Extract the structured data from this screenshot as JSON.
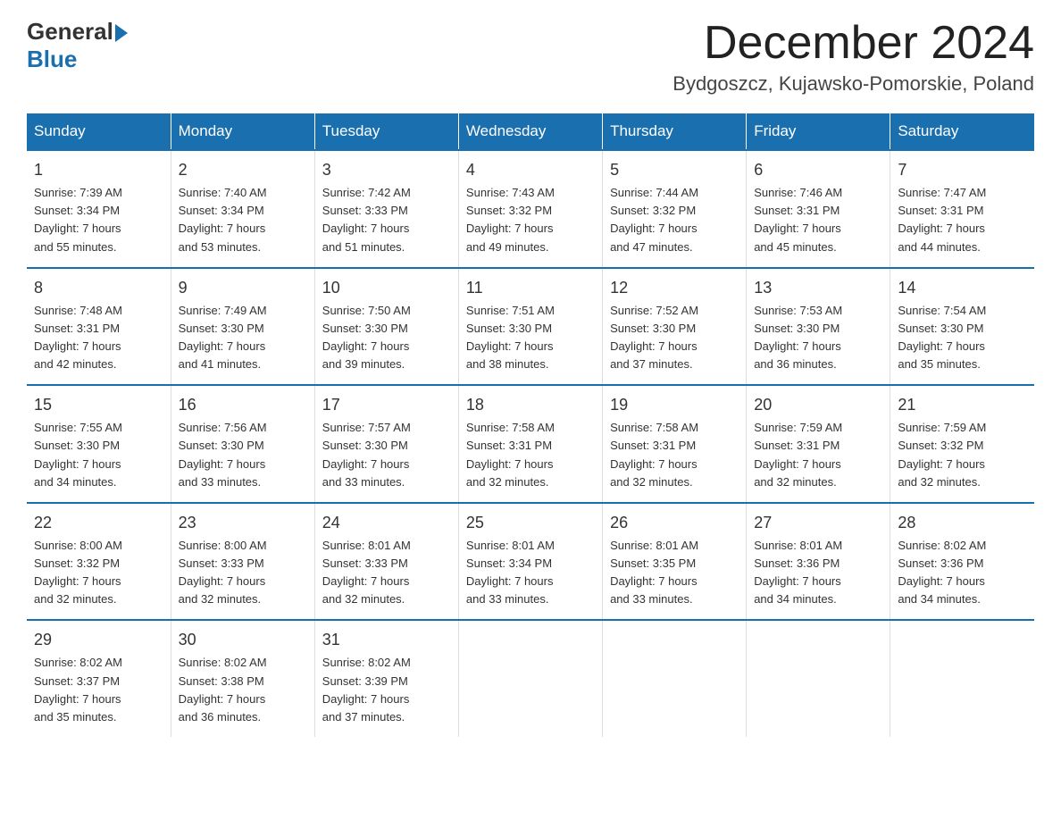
{
  "header": {
    "logo_general": "General",
    "logo_blue": "Blue",
    "month_title": "December 2024",
    "location": "Bydgoszcz, Kujawsko-Pomorskie, Poland"
  },
  "columns": [
    "Sunday",
    "Monday",
    "Tuesday",
    "Wednesday",
    "Thursday",
    "Friday",
    "Saturday"
  ],
  "weeks": [
    [
      {
        "day": "1",
        "info": "Sunrise: 7:39 AM\nSunset: 3:34 PM\nDaylight: 7 hours\nand 55 minutes."
      },
      {
        "day": "2",
        "info": "Sunrise: 7:40 AM\nSunset: 3:34 PM\nDaylight: 7 hours\nand 53 minutes."
      },
      {
        "day": "3",
        "info": "Sunrise: 7:42 AM\nSunset: 3:33 PM\nDaylight: 7 hours\nand 51 minutes."
      },
      {
        "day": "4",
        "info": "Sunrise: 7:43 AM\nSunset: 3:32 PM\nDaylight: 7 hours\nand 49 minutes."
      },
      {
        "day": "5",
        "info": "Sunrise: 7:44 AM\nSunset: 3:32 PM\nDaylight: 7 hours\nand 47 minutes."
      },
      {
        "day": "6",
        "info": "Sunrise: 7:46 AM\nSunset: 3:31 PM\nDaylight: 7 hours\nand 45 minutes."
      },
      {
        "day": "7",
        "info": "Sunrise: 7:47 AM\nSunset: 3:31 PM\nDaylight: 7 hours\nand 44 minutes."
      }
    ],
    [
      {
        "day": "8",
        "info": "Sunrise: 7:48 AM\nSunset: 3:31 PM\nDaylight: 7 hours\nand 42 minutes."
      },
      {
        "day": "9",
        "info": "Sunrise: 7:49 AM\nSunset: 3:30 PM\nDaylight: 7 hours\nand 41 minutes."
      },
      {
        "day": "10",
        "info": "Sunrise: 7:50 AM\nSunset: 3:30 PM\nDaylight: 7 hours\nand 39 minutes."
      },
      {
        "day": "11",
        "info": "Sunrise: 7:51 AM\nSunset: 3:30 PM\nDaylight: 7 hours\nand 38 minutes."
      },
      {
        "day": "12",
        "info": "Sunrise: 7:52 AM\nSunset: 3:30 PM\nDaylight: 7 hours\nand 37 minutes."
      },
      {
        "day": "13",
        "info": "Sunrise: 7:53 AM\nSunset: 3:30 PM\nDaylight: 7 hours\nand 36 minutes."
      },
      {
        "day": "14",
        "info": "Sunrise: 7:54 AM\nSunset: 3:30 PM\nDaylight: 7 hours\nand 35 minutes."
      }
    ],
    [
      {
        "day": "15",
        "info": "Sunrise: 7:55 AM\nSunset: 3:30 PM\nDaylight: 7 hours\nand 34 minutes."
      },
      {
        "day": "16",
        "info": "Sunrise: 7:56 AM\nSunset: 3:30 PM\nDaylight: 7 hours\nand 33 minutes."
      },
      {
        "day": "17",
        "info": "Sunrise: 7:57 AM\nSunset: 3:30 PM\nDaylight: 7 hours\nand 33 minutes."
      },
      {
        "day": "18",
        "info": "Sunrise: 7:58 AM\nSunset: 3:31 PM\nDaylight: 7 hours\nand 32 minutes."
      },
      {
        "day": "19",
        "info": "Sunrise: 7:58 AM\nSunset: 3:31 PM\nDaylight: 7 hours\nand 32 minutes."
      },
      {
        "day": "20",
        "info": "Sunrise: 7:59 AM\nSunset: 3:31 PM\nDaylight: 7 hours\nand 32 minutes."
      },
      {
        "day": "21",
        "info": "Sunrise: 7:59 AM\nSunset: 3:32 PM\nDaylight: 7 hours\nand 32 minutes."
      }
    ],
    [
      {
        "day": "22",
        "info": "Sunrise: 8:00 AM\nSunset: 3:32 PM\nDaylight: 7 hours\nand 32 minutes."
      },
      {
        "day": "23",
        "info": "Sunrise: 8:00 AM\nSunset: 3:33 PM\nDaylight: 7 hours\nand 32 minutes."
      },
      {
        "day": "24",
        "info": "Sunrise: 8:01 AM\nSunset: 3:33 PM\nDaylight: 7 hours\nand 32 minutes."
      },
      {
        "day": "25",
        "info": "Sunrise: 8:01 AM\nSunset: 3:34 PM\nDaylight: 7 hours\nand 33 minutes."
      },
      {
        "day": "26",
        "info": "Sunrise: 8:01 AM\nSunset: 3:35 PM\nDaylight: 7 hours\nand 33 minutes."
      },
      {
        "day": "27",
        "info": "Sunrise: 8:01 AM\nSunset: 3:36 PM\nDaylight: 7 hours\nand 34 minutes."
      },
      {
        "day": "28",
        "info": "Sunrise: 8:02 AM\nSunset: 3:36 PM\nDaylight: 7 hours\nand 34 minutes."
      }
    ],
    [
      {
        "day": "29",
        "info": "Sunrise: 8:02 AM\nSunset: 3:37 PM\nDaylight: 7 hours\nand 35 minutes."
      },
      {
        "day": "30",
        "info": "Sunrise: 8:02 AM\nSunset: 3:38 PM\nDaylight: 7 hours\nand 36 minutes."
      },
      {
        "day": "31",
        "info": "Sunrise: 8:02 AM\nSunset: 3:39 PM\nDaylight: 7 hours\nand 37 minutes."
      },
      {
        "day": "",
        "info": ""
      },
      {
        "day": "",
        "info": ""
      },
      {
        "day": "",
        "info": ""
      },
      {
        "day": "",
        "info": ""
      }
    ]
  ]
}
